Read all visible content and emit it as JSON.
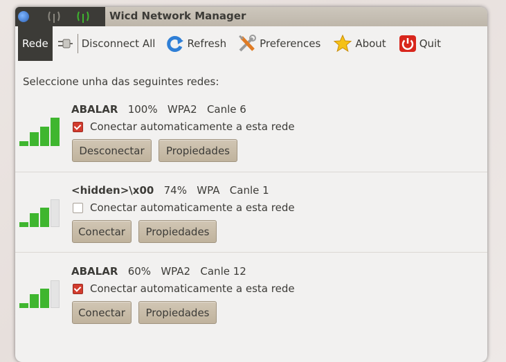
{
  "window": {
    "title": "Wicd Network Manager"
  },
  "toolbar": {
    "rede_label": "Rede",
    "disconnect_all_label": "Disconnect All",
    "refresh_label": "Refresh",
    "preferences_label": "Preferences",
    "about_label": "About",
    "quit_label": "Quit"
  },
  "heading": "Seleccione unha das seguintes redes:",
  "networks": [
    {
      "ssid": "ABALAR",
      "strength": "100%",
      "security": "WPA2",
      "channel": "Canle 6",
      "auto_label": "Conectar automaticamente a esta rede",
      "auto_checked": true,
      "connect_label": "Desconectar",
      "props_label": "Propiedades",
      "bars_filled": 4
    },
    {
      "ssid": "<hidden>\\x00",
      "strength": "74%",
      "security": "WPA",
      "channel": "Canle 1",
      "auto_label": "Conectar automaticamente a esta rede",
      "auto_checked": false,
      "connect_label": "Conectar",
      "props_label": "Propiedades",
      "bars_filled": 3
    },
    {
      "ssid": "ABALAR",
      "strength": "60%",
      "security": "WPA2",
      "channel": "Canle 12",
      "auto_label": "Conectar automaticamente a esta rede",
      "auto_checked": true,
      "connect_label": "Conectar",
      "props_label": "Propiedades",
      "bars_filled": 3
    }
  ],
  "colors": {
    "signal_green": "#3fb62f",
    "signal_empty": "#e4e4e4",
    "checkbox_red": "#d23c2e",
    "quit_red": "#d8261c"
  }
}
